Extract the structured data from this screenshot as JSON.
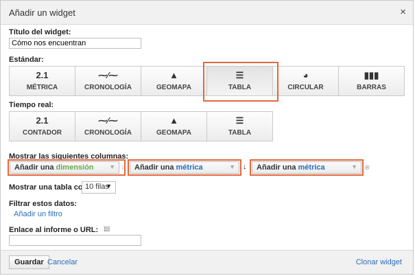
{
  "dialog": {
    "title": "Añadir un widget",
    "close_glyph": "×"
  },
  "widget_title": {
    "label": "Título del widget:",
    "value": "Cómo nos encuentran"
  },
  "standard": {
    "label": "Estándar:",
    "buttons": [
      {
        "icon_text": "2.1",
        "label": "MÉTRICA",
        "icon": "metric-icon"
      },
      {
        "icon_text": "⁓∕⁓",
        "label": "CRONOLOGÍA",
        "icon": "timeline-icon"
      },
      {
        "icon_text": "▲",
        "label": "GEOMAPA",
        "icon": "geomap-icon"
      },
      {
        "icon_text": "☰",
        "label": "TABLA",
        "icon": "table-icon",
        "selected": true
      },
      {
        "icon_text": "◕",
        "label": "CIRCULAR",
        "icon": "pie-icon"
      },
      {
        "icon_text": "▮▮▮",
        "label": "BARRAS",
        "icon": "bars-icon"
      }
    ]
  },
  "realtime": {
    "label": "Tiempo real:",
    "buttons": [
      {
        "icon_text": "2.1",
        "label": "CONTADOR",
        "icon": "counter-icon"
      },
      {
        "icon_text": "⁓∕⁓",
        "label": "CRONOLOGÍA",
        "icon": "timeline-icon"
      },
      {
        "icon_text": "▲",
        "label": "GEOMAPA",
        "icon": "geomap-icon"
      },
      {
        "icon_text": "☰",
        "label": "TABLA",
        "icon": "table-icon"
      }
    ]
  },
  "columns": {
    "label": "Mostrar las siguientes columnas:",
    "dimension": {
      "prefix": "Añadir una ",
      "keyword": "dimensión"
    },
    "metric1": {
      "prefix": "Añadir una ",
      "keyword": "métrica"
    },
    "metric2": {
      "prefix": "Añadir una ",
      "keyword": "métrica"
    }
  },
  "table_rows": {
    "label": "Mostrar una tabla con",
    "value": "10 filas"
  },
  "filter": {
    "label": "Filtrar estos datos:",
    "link": "Añadir un filtro"
  },
  "link_url": {
    "label": "Enlace al informe o URL:",
    "value": ""
  },
  "footer": {
    "save": "Guardar",
    "cancel": "Cancelar",
    "clone": "Clonar widget"
  },
  "colors": {
    "highlight": "#e0683c",
    "link": "#2a6cbb",
    "dimension_green": "#6aa84f"
  }
}
